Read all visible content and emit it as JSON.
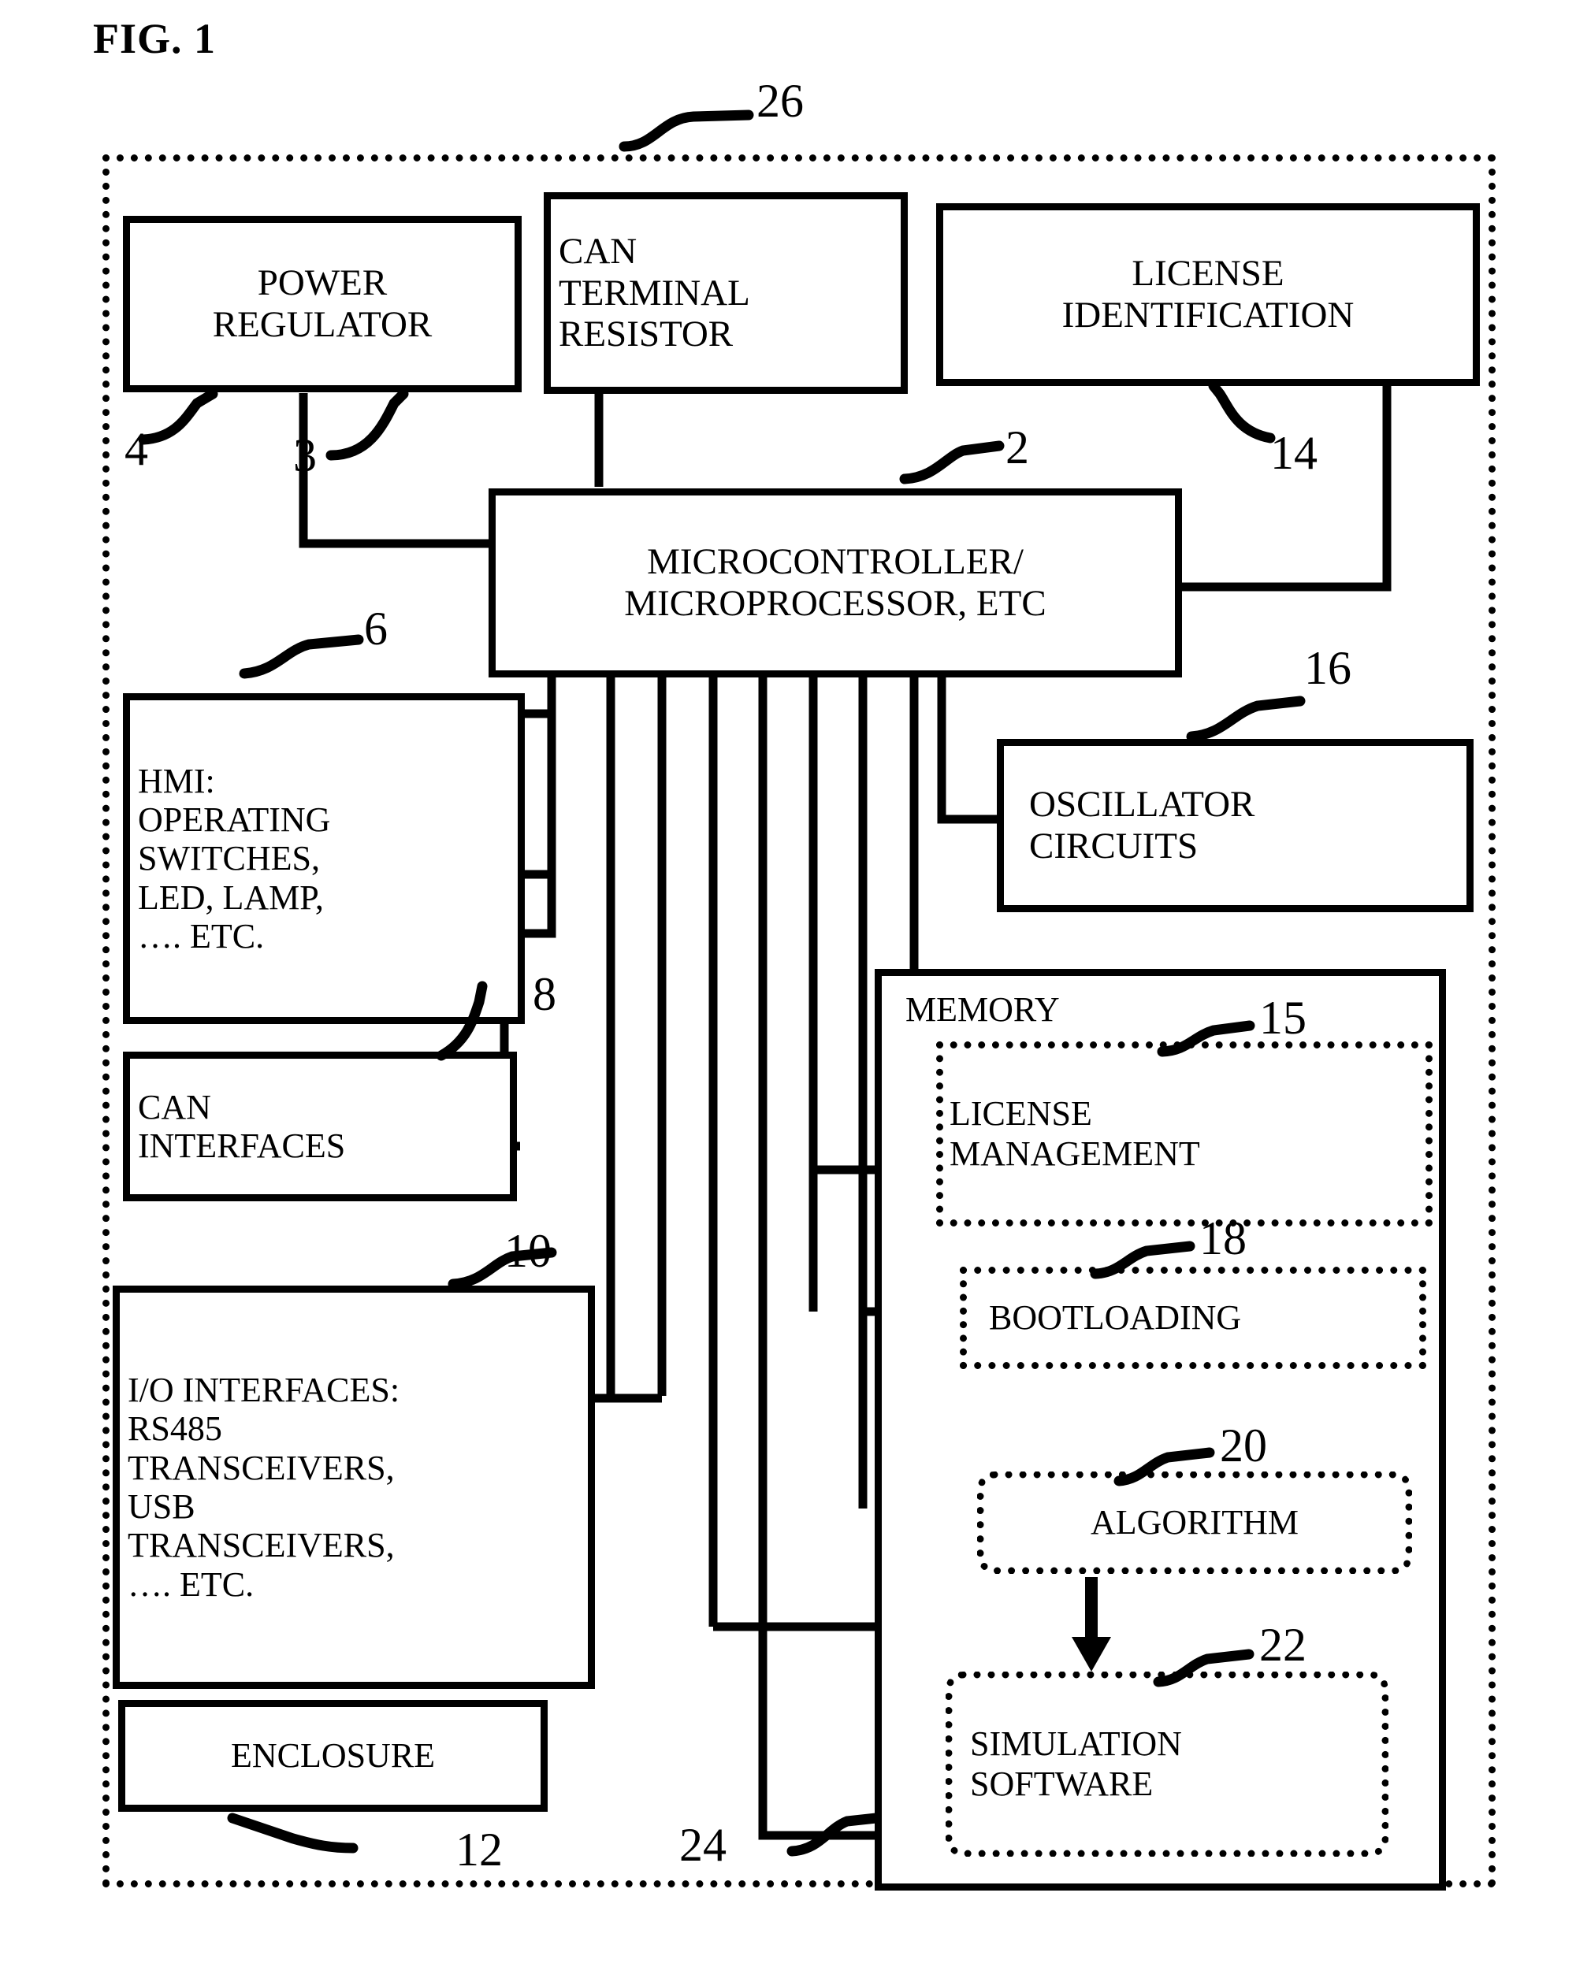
{
  "figure": {
    "caption": "FIG. 1"
  },
  "enclosure": {
    "ref": "26",
    "description": "outer dotted system boundary"
  },
  "blocks": [
    {
      "id": "power_regulator",
      "label": "POWER\nREGULATOR",
      "ref": "4"
    },
    {
      "id": "can_terminal_resistor",
      "label": "CAN\nTERMINAL\nRESISTOR",
      "ref": "3"
    },
    {
      "id": "license_identification",
      "label": "LICENSE\nIDENTIFICATION",
      "ref": "14"
    },
    {
      "id": "microcontroller",
      "label": "MICROCONTROLLER/\nMICROPROCESSOR, ETC",
      "ref": "2"
    },
    {
      "id": "hmi",
      "label": "HMI:\nOPERATING\nSWITCHES,\nLED, LAMP,\n…. ETC.",
      "ref": "6"
    },
    {
      "id": "oscillator_circuits",
      "label": "OSCILLATOR\nCIRCUITS",
      "ref": "16"
    },
    {
      "id": "can_interfaces",
      "label": "CAN\nINTERFACES",
      "ref": "8"
    },
    {
      "id": "io_interfaces",
      "label": "I/O INTERFACES:\nRS485\nTRANSCEIVERS,\nUSB\nTRANSCEIVERS,\n…. ETC.",
      "ref": "10"
    },
    {
      "id": "enclosure_box",
      "label": "ENCLOSURE",
      "ref": "12"
    },
    {
      "id": "memory",
      "label": "MEMORY",
      "ref": "24"
    }
  ],
  "memory_items": [
    {
      "id": "license_management",
      "label": "LICENSE\nMANAGEMENT",
      "ref": "15"
    },
    {
      "id": "bootloading",
      "label": "BOOTLOADING",
      "ref": "18"
    },
    {
      "id": "algorithm",
      "label": "ALGORITHM",
      "ref": "20"
    },
    {
      "id": "simulation_software",
      "label": "SIMULATION\nSOFTWARE",
      "ref": "22"
    }
  ],
  "refs": {
    "r2": "2",
    "r3": "3",
    "r4": "4",
    "r6": "6",
    "r8": "8",
    "r10": "10",
    "r12": "12",
    "r14": "14",
    "r15": "15",
    "r16": "16",
    "r18": "18",
    "r20": "20",
    "r22": "22",
    "r24": "24",
    "r26": "26"
  },
  "colors": {
    "ink": "#000000",
    "paper": "#ffffff"
  }
}
